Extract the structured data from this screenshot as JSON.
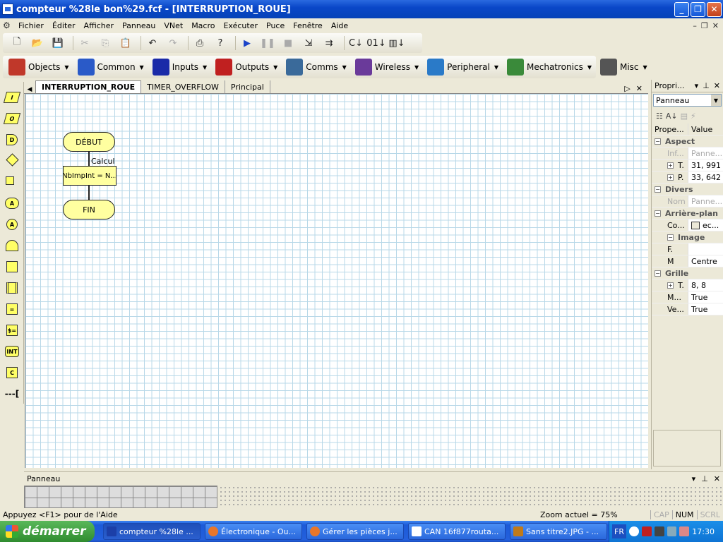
{
  "window": {
    "title": "compteur %28le bon%29.fcf - [INTERRUPTION_ROUE]"
  },
  "menu": [
    "Fichier",
    "Éditer",
    "Afficher",
    "Panneau",
    "VNet",
    "Macro",
    "Exécuter",
    "Puce",
    "Fenêtre",
    "Aide"
  ],
  "toolbar1": [
    "new-icon",
    "open-icon",
    "save-icon",
    "cut-icon",
    "copy-icon",
    "paste-icon",
    "undo-icon",
    "redo-icon",
    "print-icon",
    "help-icon",
    "run-icon",
    "pause-icon",
    "stop-icon",
    "step-into-icon",
    "step-over-icon",
    "compile-c-icon",
    "compile-hex-icon",
    "compile-chip-icon"
  ],
  "components": [
    {
      "label": "Objects",
      "icon": "objects-icon",
      "color": "#c0382a"
    },
    {
      "label": "Common",
      "icon": "common-icon",
      "color": "#2a5ac8"
    },
    {
      "label": "Inputs",
      "icon": "inputs-icon",
      "color": "#1a2aa8"
    },
    {
      "label": "Outputs",
      "icon": "outputs-icon",
      "color": "#c02020"
    },
    {
      "label": "Comms",
      "icon": "comms-icon",
      "color": "#3a6a9a"
    },
    {
      "label": "Wireless",
      "icon": "wireless-icon",
      "color": "#6a3a9a"
    },
    {
      "label": "Peripheral",
      "icon": "peripheral-icon",
      "color": "#2a7ac8"
    },
    {
      "label": "Mechatronics",
      "icon": "mechatronics-icon",
      "color": "#3a8a3a"
    },
    {
      "label": "Misc",
      "icon": "misc-icon",
      "color": "#555555"
    }
  ],
  "left_symbols": [
    {
      "name": "input-symbol",
      "text": "I"
    },
    {
      "name": "output-symbol",
      "text": "O"
    },
    {
      "name": "delay-symbol",
      "text": "D"
    },
    {
      "name": "decision-symbol",
      "text": ""
    },
    {
      "name": "loop-symbol",
      "text": ""
    },
    {
      "name": "macro-call-symbol",
      "text": "A"
    },
    {
      "name": "component-macro-symbol",
      "text": "A"
    },
    {
      "name": "interrupt-symbol",
      "text": ""
    },
    {
      "name": "calculation-symbol",
      "text": ""
    },
    {
      "name": "code-symbol",
      "text": ""
    },
    {
      "name": "string-symbol",
      "text": "="
    },
    {
      "name": "string-manip-symbol",
      "text": "$="
    },
    {
      "name": "interrupt-int-symbol",
      "text": "INT"
    },
    {
      "name": "c-code-symbol",
      "text": "C"
    },
    {
      "name": "comment-symbol",
      "text": "---["
    }
  ],
  "doc_tabs": [
    "INTERRUPTION_ROUE",
    "TIMER_OVERFLOW",
    "Principal"
  ],
  "flowchart": {
    "start": "DÉBUT",
    "calc_label": "Calcul",
    "calc_text": "NbImpInt = N...",
    "end": "FIN"
  },
  "properties": {
    "title": "Propri...",
    "object": "Panneau",
    "col_prop": "Prope...",
    "col_val": "Value",
    "rows": [
      {
        "type": "cat",
        "key": "Aspect"
      },
      {
        "type": "gray",
        "key": "Inf...",
        "val": "Panne..."
      },
      {
        "type": "exp",
        "key": "T.",
        "val": "31, 991"
      },
      {
        "type": "exp",
        "key": "P.",
        "val": "33, 642"
      },
      {
        "type": "cat",
        "key": "Divers"
      },
      {
        "type": "gray",
        "key": "Nom",
        "val": "Panne..."
      },
      {
        "type": "cat",
        "key": "Arrière-plan"
      },
      {
        "type": "row",
        "key": "Co...",
        "val": "ec..."
      },
      {
        "type": "subcat",
        "key": "Image"
      },
      {
        "type": "row",
        "key": "F.",
        "val": ""
      },
      {
        "type": "row",
        "key": "M",
        "val": "Centre"
      },
      {
        "type": "cat",
        "key": "Grille"
      },
      {
        "type": "exp",
        "key": "T.",
        "val": "8, 8"
      },
      {
        "type": "row",
        "key": "M...",
        "val": "True"
      },
      {
        "type": "row",
        "key": "Ve...",
        "val": "True"
      }
    ]
  },
  "panel": {
    "title": "Panneau"
  },
  "status": {
    "help": "Appuyez <F1> pour de l'Aide",
    "zoom": "Zoom actuel = 75%",
    "cap": "CAP",
    "num": "NUM",
    "scrl": "SCRL"
  },
  "taskbar": {
    "start": "démarrer",
    "tasks": [
      "compteur %28le ...",
      "Électronique - Ou...",
      "Gérer les pièces j...",
      "CAN 16f877routa...",
      "Sans titre2.JPG - ..."
    ],
    "lang": "FR",
    "clock": "17:30"
  }
}
